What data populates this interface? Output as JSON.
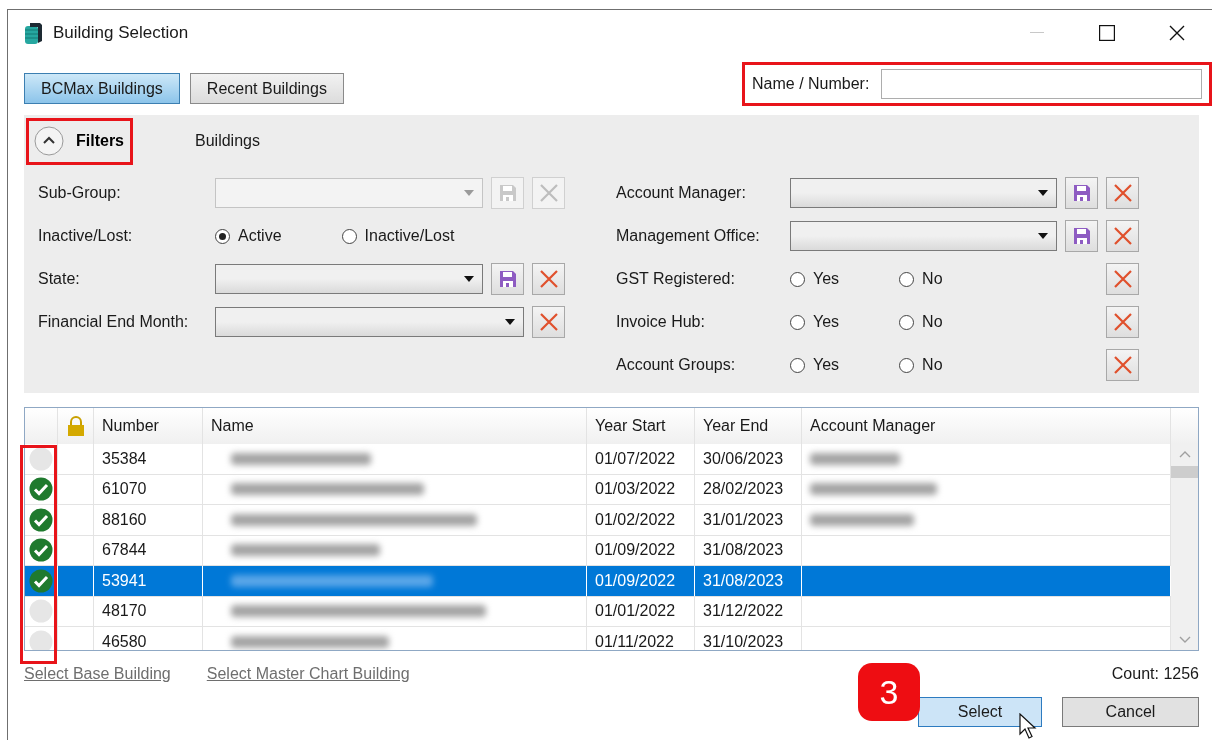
{
  "window": {
    "title": "Building Selection"
  },
  "tabs": [
    {
      "label": "BCMax Buildings",
      "selected": true
    },
    {
      "label": "Recent Buildings",
      "selected": false
    }
  ],
  "search": {
    "label": "Name / Number:",
    "highlighted": true
  },
  "filters": {
    "toggle_label": "Filters",
    "expanded": true,
    "highlighted": true,
    "section_label": "Buildings",
    "left": [
      {
        "kind": "dropdown",
        "label": "Sub-Group:",
        "disabled": true,
        "save": true,
        "clear": true
      },
      {
        "kind": "radio",
        "label": "Inactive/Lost:",
        "clear": false,
        "options": [
          {
            "label": "Active",
            "selected": true
          },
          {
            "label": "Inactive/Lost",
            "selected": false
          }
        ]
      },
      {
        "kind": "dropdown",
        "label": "State:",
        "disabled": false,
        "save": true,
        "clear": true
      },
      {
        "kind": "dropdown",
        "label": "Financial End Month:",
        "disabled": false,
        "save": false,
        "clear": true
      }
    ],
    "right": [
      {
        "kind": "dropdown",
        "label": "Account Manager:",
        "disabled": false,
        "save": true,
        "clear": true
      },
      {
        "kind": "dropdown",
        "label": "Management Office:",
        "disabled": false,
        "save": true,
        "clear": true
      },
      {
        "kind": "radio",
        "label": "GST Registered:",
        "clear": true,
        "options": [
          {
            "label": "Yes",
            "selected": false
          },
          {
            "label": "No",
            "selected": false
          }
        ]
      },
      {
        "kind": "radio",
        "label": "Invoice Hub:",
        "clear": true,
        "options": [
          {
            "label": "Yes",
            "selected": false
          },
          {
            "label": "No",
            "selected": false
          }
        ]
      },
      {
        "kind": "radio",
        "label": "Account Groups:",
        "clear": true,
        "options": [
          {
            "label": "Yes",
            "selected": false
          },
          {
            "label": "No",
            "selected": false
          }
        ]
      }
    ]
  },
  "table": {
    "check_column_highlighted": true,
    "columns": [
      {
        "kind": "check"
      },
      {
        "kind": "lock"
      },
      {
        "kind": "text",
        "label": "Number"
      },
      {
        "kind": "text",
        "label": "Name"
      },
      {
        "kind": "text",
        "label": "Year Start"
      },
      {
        "kind": "text",
        "label": "Year End"
      },
      {
        "kind": "text",
        "label": "Account Manager"
      }
    ],
    "rows": [
      {
        "checked": false,
        "selected": false,
        "number": "35384",
        "name_blurred": true,
        "year_start": "01/07/2022",
        "year_end": "30/06/2023",
        "manager_blurred": true
      },
      {
        "checked": true,
        "selected": false,
        "number": "61070",
        "name_blurred": true,
        "year_start": "01/03/2022",
        "year_end": "28/02/2023",
        "manager_blurred": true
      },
      {
        "checked": true,
        "selected": false,
        "number": "88160",
        "name_blurred": true,
        "year_start": "01/02/2022",
        "year_end": "31/01/2023",
        "manager_blurred": true
      },
      {
        "checked": true,
        "selected": false,
        "number": "67844",
        "name_blurred": true,
        "year_start": "01/09/2022",
        "year_end": "31/08/2023",
        "manager_blurred": false
      },
      {
        "checked": true,
        "selected": true,
        "number": "53941",
        "name_blurred": true,
        "year_start": "01/09/2022",
        "year_end": "31/08/2023",
        "manager_blurred": false
      },
      {
        "checked": false,
        "selected": false,
        "number": "48170",
        "name_blurred": true,
        "year_start": "01/01/2022",
        "year_end": "31/12/2022",
        "manager_blurred": false
      },
      {
        "checked": false,
        "selected": false,
        "number": "46580",
        "name_blurred": true,
        "year_start": "01/11/2022",
        "year_end": "31/10/2023",
        "manager_blurred": false
      }
    ]
  },
  "links": [
    "Select Base Building",
    "Select Master Chart Building"
  ],
  "count": "Count: 1256",
  "step_badge": "3",
  "buttons": [
    {
      "label": "Select",
      "kind": "primary"
    },
    {
      "label": "Cancel",
      "kind": "default"
    }
  ]
}
